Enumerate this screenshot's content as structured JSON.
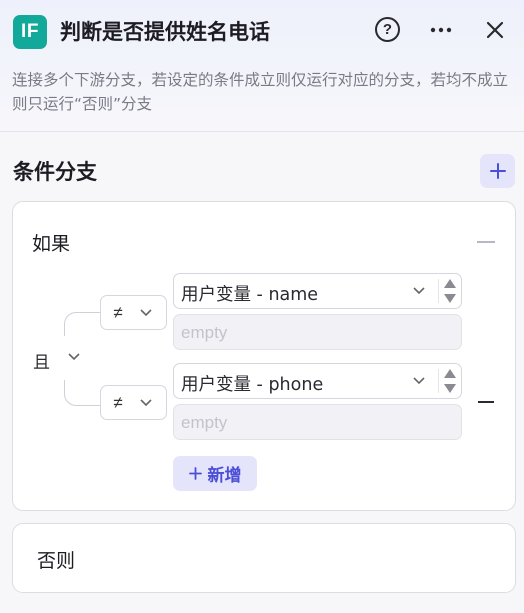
{
  "header": {
    "badge": "IF",
    "title": "判断是否提供姓名电话",
    "help_symbol": "?",
    "description": "连接多个下游分支，若设定的条件成立则仅运行对应的分支，若均不成立则只运行“否则”分支"
  },
  "section": {
    "title": "条件分支"
  },
  "branch_if": {
    "label": "如果",
    "logic": "且",
    "conditions": [
      {
        "operator": "≠",
        "variable": "用户变量 - name",
        "value_placeholder": "empty"
      },
      {
        "operator": "≠",
        "variable": "用户变量 - phone",
        "value_placeholder": "empty"
      }
    ],
    "add_condition_label": "新增"
  },
  "branch_else": {
    "label": "否则"
  },
  "colors": {
    "badge": "#12a99b",
    "accent": "#4b4ed6",
    "accent_bg": "#e4e5fb"
  },
  "icons": [
    "help-icon",
    "more-icon",
    "close-icon",
    "plus-icon",
    "collapse-icon",
    "chevron-down-icon",
    "stepper-icon",
    "minus-icon"
  ]
}
